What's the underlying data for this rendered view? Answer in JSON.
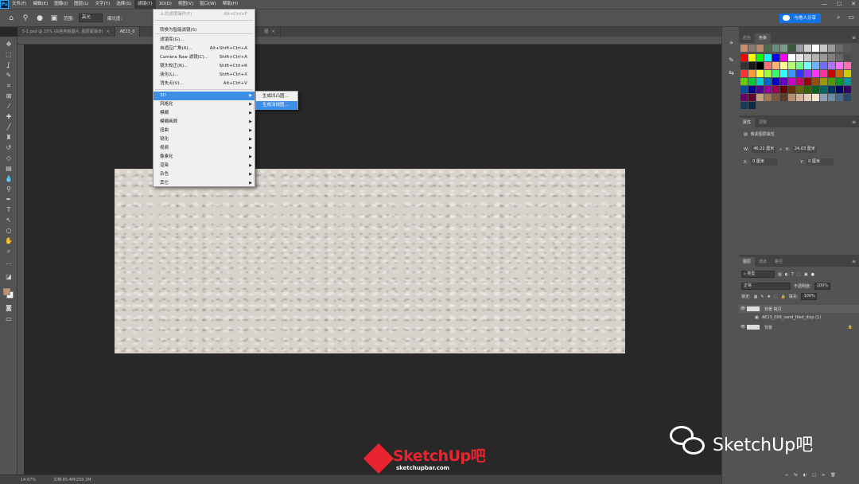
{
  "app": {
    "logo": "Ps"
  },
  "menubar": [
    "文件(F)",
    "编辑(E)",
    "图像(I)",
    "图层(L)",
    "文字(Y)",
    "选择(S)",
    "滤镜(T)",
    "3D(D)",
    "视图(V)",
    "窗口(W)",
    "帮助(H)"
  ],
  "window_controls": [
    "—",
    "☐",
    "✕"
  ],
  "options": {
    "range_label": "范围:",
    "range_value": "高光",
    "exposure_label": "曝光度:",
    "share_label": "与他人分享"
  },
  "tabs": [
    {
      "label": "5-1.psd @ 25% (白色地板图片, 图层蒙版/8)",
      "close": "×"
    },
    {
      "label": "AE23_0",
      "close": ""
    },
    {
      "label": "图",
      "close": "×"
    }
  ],
  "filter_menu": {
    "items": [
      {
        "label": "上次滤镜操作(F)",
        "shortcut": "Alt+Ctrl+F",
        "disabled": true
      },
      {
        "label": "转换为智能滤镜(S)",
        "shortcut": ""
      },
      {
        "label": "滤镜库(G)...",
        "shortcut": ""
      },
      {
        "label": "自适应广角(A)...",
        "shortcut": "Alt+Shift+Ctrl+A"
      },
      {
        "label": "Camera Raw 滤镜(C)...",
        "shortcut": "Shift+Ctrl+A"
      },
      {
        "label": "镜头校正(R)...",
        "shortcut": "Shift+Ctrl+R"
      },
      {
        "label": "液化(L)...",
        "shortcut": "Shift+Ctrl+X"
      },
      {
        "label": "消失点(V)...",
        "shortcut": "Alt+Ctrl+V"
      },
      {
        "label": "3D",
        "shortcut": "",
        "submenu": true,
        "hover": true
      },
      {
        "label": "风格化",
        "submenu": true
      },
      {
        "label": "模糊",
        "submenu": true
      },
      {
        "label": "模糊画廊",
        "submenu": true
      },
      {
        "label": "扭曲",
        "submenu": true
      },
      {
        "label": "锐化",
        "submenu": true
      },
      {
        "label": "视频",
        "submenu": true
      },
      {
        "label": "像素化",
        "submenu": true
      },
      {
        "label": "渲染",
        "submenu": true
      },
      {
        "label": "杂色",
        "submenu": true
      },
      {
        "label": "其它",
        "submenu": true
      }
    ],
    "submenu_3d": [
      {
        "label": "生成凹凸图..."
      },
      {
        "label": "生成法线图...",
        "hover": true
      }
    ]
  },
  "status": {
    "zoom": "14.67%",
    "doc": "文档:85.4M/259.3M"
  },
  "panels": {
    "color_tabs": [
      "颜色",
      "色板"
    ],
    "props_tabs": [
      "属性",
      "调整"
    ],
    "props_title": "像素图层属性",
    "w_label": "W:",
    "w_value": "46.22 厘米",
    "link_icon": "∞",
    "h_label": "H:",
    "h_value": "24.03 厘米",
    "x_label": "X:",
    "x_value": "0 厘米",
    "y_label": "Y:",
    "y_value": "0 厘米",
    "layers_tabs": [
      "图层",
      "通道",
      "路径"
    ],
    "kind_label": "类型",
    "blend_mode": "正常",
    "opacity_label": "不透明度:",
    "opacity_value": "100%",
    "lock_label": "锁定:",
    "fill_label": "填充:",
    "fill_value": "100%",
    "layers": [
      {
        "name": "背景 拷贝",
        "selected": true
      },
      {
        "name": "AE23_009_sand_tiled_disp (1)",
        "indent": true
      },
      {
        "name": "背景",
        "locked": true
      }
    ],
    "bottom_icons": [
      "∞",
      "fx",
      "◐",
      "□",
      "+",
      "🗑"
    ]
  },
  "swatch_colors": {
    "recent": [
      "#c98d6f",
      "#8a7a6c",
      "#bb8a6a",
      "#4e6a4c",
      "#6a8a7c",
      "#7a9a8a",
      "#3a5a3a",
      "#9a9aa6",
      "#d0d0d0",
      "#ffffff",
      "#c8c8c8",
      "#9a9a9a",
      "#6a6a6a",
      "#5a5a5a"
    ],
    "grid": [
      "#ff0000",
      "#ffff00",
      "#00ff00",
      "#00ffff",
      "#0000ff",
      "#ff00ff",
      "#ffffff",
      "#e6e6e6",
      "#cccccc",
      "#b3b3b3",
      "#999999",
      "#808080",
      "#666666",
      "#4d4d4d",
      "#333333",
      "#1a1a1a",
      "#000000",
      "#ff6f6f",
      "#ffb36f",
      "#ffff8a",
      "#b3ff6f",
      "#6fff8a",
      "#6fffff",
      "#6fb3ff",
      "#6f6fff",
      "#b36fff",
      "#ff6fff",
      "#ff6fb3",
      "#ff3333",
      "#ff9933",
      "#ffff33",
      "#99ff33",
      "#33ff66",
      "#33ffff",
      "#3399ff",
      "#3333ff",
      "#9933ff",
      "#ff33ff",
      "#ff3399",
      "#cc0000",
      "#cc6600",
      "#cccc00",
      "#66cc00",
      "#00cc33",
      "#00cccc",
      "#0066cc",
      "#0000cc",
      "#6600cc",
      "#cc00cc",
      "#cc0066",
      "#990000",
      "#994d00",
      "#999900",
      "#4d9900",
      "#009926",
      "#009999",
      "#004d99",
      "#000099",
      "#4d0099",
      "#990099",
      "#99004d",
      "#660000",
      "#663300",
      "#666600",
      "#336600",
      "#00661a",
      "#006666",
      "#003366",
      "#000066",
      "#330066",
      "#660066",
      "#660033",
      "#c6a080",
      "#a07858",
      "#7a5a40",
      "#5a3c28",
      "#b89070",
      "#d4b494",
      "#e8d0b8",
      "#f4e4d0",
      "#8aa0b8",
      "#6a8aa8",
      "#4a6a8a",
      "#2a4a6a",
      "#1a3a5a",
      "#0a2a4a"
    ]
  },
  "watermark": {
    "brand": "SketchUp吧",
    "url": "sketchupbar.com",
    "wechat_text": "SketchUp吧"
  }
}
